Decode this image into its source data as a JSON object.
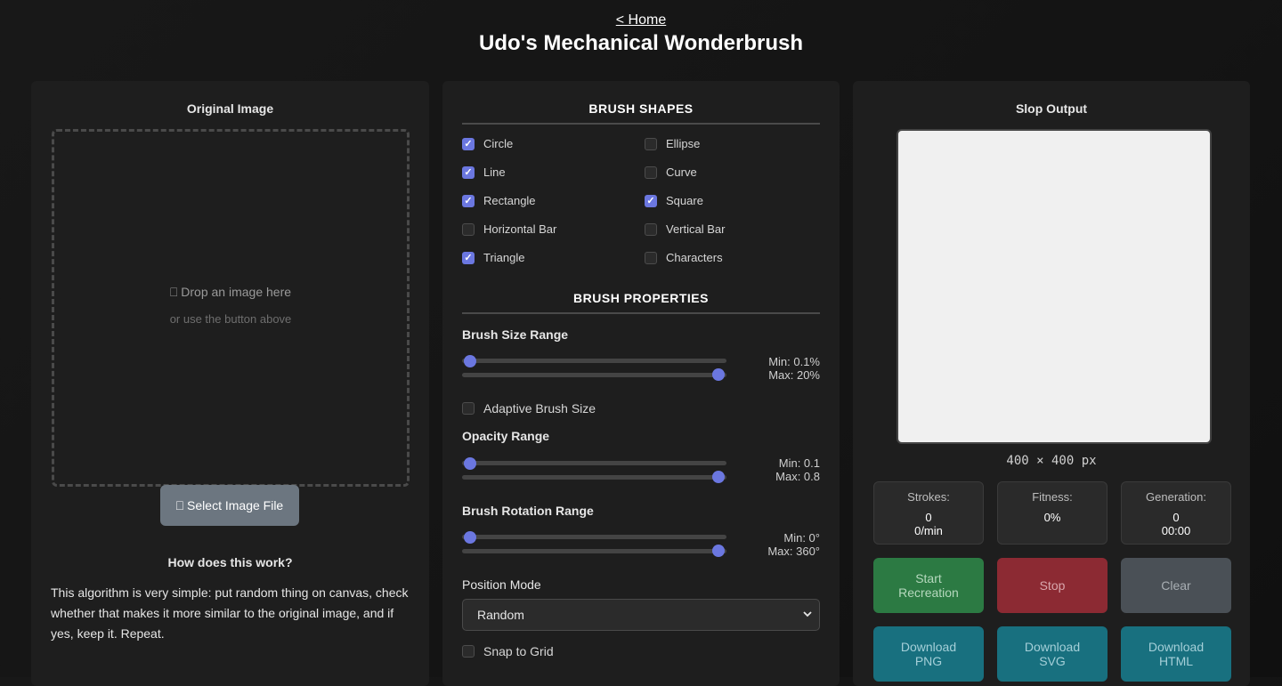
{
  "header": {
    "home_link": "< Home",
    "title": "Udo's Mechanical Wonderbrush"
  },
  "left_panel": {
    "heading": "Original Image",
    "drop_text": "⎕ Drop an image here",
    "drop_subtext": "or use the button above",
    "select_button": "⎕ Select Image File",
    "how_title": "How does this work?",
    "how_text": "This algorithm is very simple: put random thing on canvas, check whether that makes it more similar to the original image, and if yes, keep it. Repeat."
  },
  "brush_shapes": {
    "heading": "BRUSH SHAPES",
    "items": [
      {
        "label": "Circle",
        "checked": true
      },
      {
        "label": "Ellipse",
        "checked": false
      },
      {
        "label": "Line",
        "checked": true
      },
      {
        "label": "Curve",
        "checked": false
      },
      {
        "label": "Rectangle",
        "checked": true
      },
      {
        "label": "Square",
        "checked": true
      },
      {
        "label": "Horizontal Bar",
        "checked": false
      },
      {
        "label": "Vertical Bar",
        "checked": false
      },
      {
        "label": "Triangle",
        "checked": true
      },
      {
        "label": "Characters",
        "checked": false
      }
    ]
  },
  "brush_properties": {
    "heading": "BRUSH PROPERTIES",
    "size": {
      "label": "Brush Size Range",
      "min_text": "Min: 0.1%",
      "max_text": "Max: 20%"
    },
    "adaptive": {
      "label": "Adaptive Brush Size",
      "checked": false
    },
    "opacity": {
      "label": "Opacity Range",
      "min_text": "Min: 0.1",
      "max_text": "Max: 0.8"
    },
    "rotation": {
      "label": "Brush Rotation Range",
      "min_text": "Min: 0°",
      "max_text": "Max: 360°"
    },
    "position_mode": {
      "label": "Position Mode",
      "selected": "Random"
    },
    "snap": {
      "label": "Snap to Grid",
      "checked": false
    }
  },
  "output": {
    "heading": "Slop Output",
    "dims": "400 × 400 px",
    "stats": {
      "strokes": {
        "label": "Strokes:",
        "value": "0",
        "rate": "0/min"
      },
      "fitness": {
        "label": "Fitness:",
        "value": "0%"
      },
      "generation": {
        "label": "Generation:",
        "value": "0",
        "time": "00:00"
      }
    },
    "buttons": {
      "start": "Start Recreation",
      "stop": "Stop",
      "clear": "Clear",
      "download_png": "Download PNG",
      "download_svg": "Download SVG",
      "download_html": "Download HTML"
    }
  },
  "colors": {
    "accent": "#6b77e0",
    "panel": "#1e1e1e",
    "start": "#2c7a43",
    "stop": "#8c2a33",
    "download": "#18707f"
  }
}
